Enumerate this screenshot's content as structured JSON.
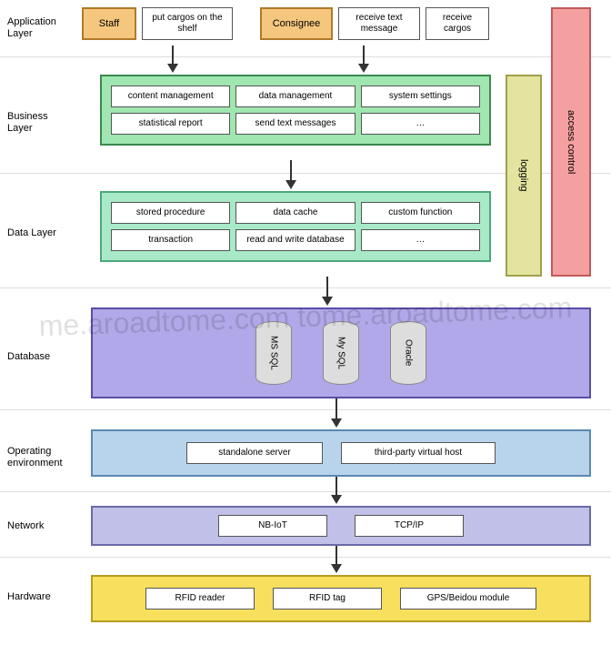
{
  "layers": {
    "application": {
      "label": "Application Layer"
    },
    "business": {
      "label": "Business Layer"
    },
    "data": {
      "label": "Data Layer"
    },
    "database": {
      "label": "Database"
    },
    "openv": {
      "label": "Operating environment"
    },
    "network": {
      "label": "Network"
    },
    "hardware": {
      "label": "Hardware"
    }
  },
  "application": {
    "staff": {
      "label": "Staff",
      "action": "put cargos on the shelf"
    },
    "consignee": {
      "label": "Consignee",
      "action1": "receive text message",
      "action2": "receive cargos"
    }
  },
  "business": {
    "b1": "content management",
    "b2": "data management",
    "b3": "system settings",
    "b4": "statistical report",
    "b5": "send text messages",
    "b6": "…"
  },
  "data": {
    "d1": "stored procedure",
    "d2": "data cache",
    "d3": "custom function",
    "d4": "transaction",
    "d5": "read and write database",
    "d6": "…"
  },
  "database": {
    "c1": "MS SQL",
    "c2": "My SQL",
    "c3": "Oracle"
  },
  "openv": {
    "o1": "standalone server",
    "o2": "third-party virtual host"
  },
  "network": {
    "n1": "NB-IoT",
    "n2": "TCP/IP"
  },
  "hardware": {
    "h1": "RFID reader",
    "h2": "RFID tag",
    "h3": "GPS/Beidou module"
  },
  "side": {
    "logging": "logging",
    "access": "access control"
  },
  "watermark": "me.aroadtome.com tome.aroadtome.com"
}
